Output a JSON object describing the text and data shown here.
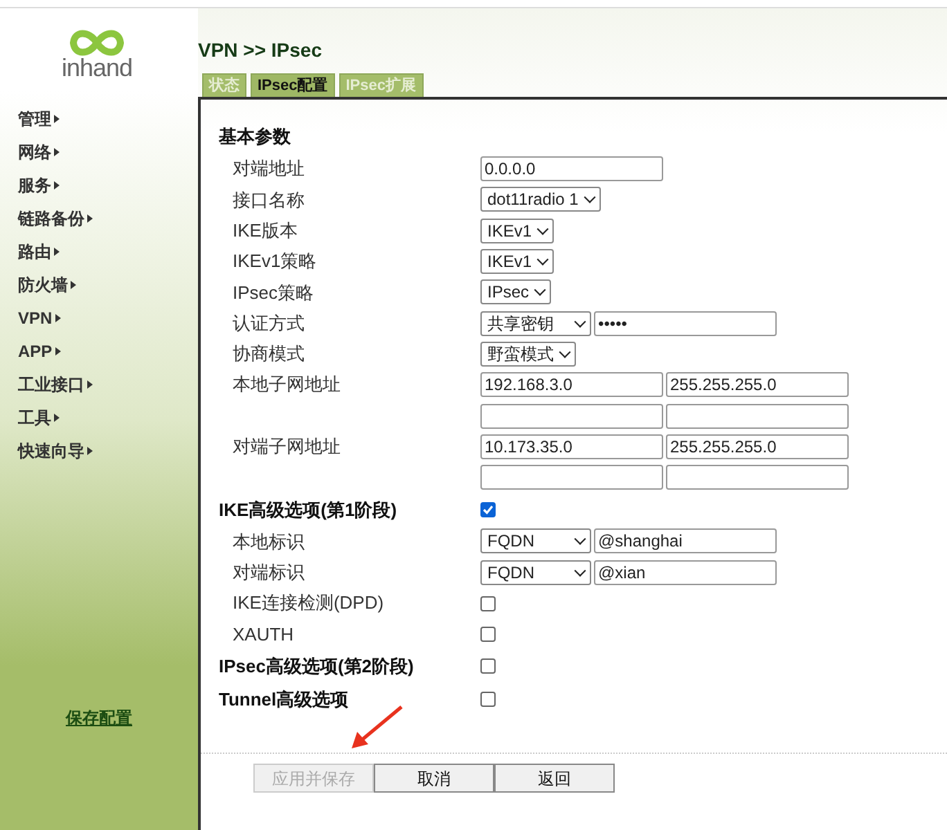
{
  "logo": {
    "text": "inhand"
  },
  "sidebar": {
    "items": [
      {
        "label": "管理"
      },
      {
        "label": "网络"
      },
      {
        "label": "服务"
      },
      {
        "label": "链路备份"
      },
      {
        "label": "路由"
      },
      {
        "label": "防火墙"
      },
      {
        "label": "VPN"
      },
      {
        "label": "APP"
      },
      {
        "label": "工业接口"
      },
      {
        "label": "工具"
      },
      {
        "label": "快速向导"
      }
    ],
    "save_link": "保存配置"
  },
  "breadcrumb": "VPN >> IPsec",
  "tabs": [
    {
      "label": "状态",
      "selected": false
    },
    {
      "label": "IPsec配置",
      "selected": true
    },
    {
      "label": "IPsec扩展",
      "selected": false
    }
  ],
  "rows": [
    {
      "kind": "heading",
      "label": "基本参数"
    },
    {
      "kind": "input",
      "label": "对端地址",
      "value": "0.0.0.0"
    },
    {
      "kind": "select",
      "label": "接口名称",
      "value": "dot11radio 1"
    },
    {
      "kind": "select",
      "label": "IKE版本",
      "value": "IKEv1"
    },
    {
      "kind": "select",
      "label": "IKEv1策略",
      "value": "IKEv1"
    },
    {
      "kind": "select",
      "label": "IPsec策略",
      "value": "IPsec"
    },
    {
      "kind": "select-input",
      "label": "认证方式",
      "value": "共享密钥",
      "input_value": "•••••"
    },
    {
      "kind": "select",
      "label": "协商模式",
      "value": "野蛮模式"
    },
    {
      "kind": "pair",
      "label": "本地子网地址",
      "values": [
        "192.168.3.0",
        "255.255.255.0"
      ]
    },
    {
      "kind": "pair"
    },
    {
      "kind": "pair",
      "label": "对端子网地址",
      "values": [
        "10.173.35.0",
        "255.255.255.0"
      ]
    },
    {
      "kind": "pair"
    },
    {
      "kind": "check-heading",
      "label": "IKE高级选项(第1阶段)",
      "checked": true
    },
    {
      "kind": "select-input",
      "label": "本地标识",
      "value": "FQDN",
      "input_value": "@shanghai"
    },
    {
      "kind": "select-input",
      "label": "对端标识",
      "value": "FQDN",
      "input_value": "@xian"
    },
    {
      "kind": "checkbox",
      "label": "IKE连接检测(DPD)",
      "checked": false
    },
    {
      "kind": "checkbox",
      "label": "XAUTH",
      "checked": false
    },
    {
      "kind": "check-heading",
      "label": "IPsec高级选项(第2阶段)",
      "checked": false
    },
    {
      "kind": "check-heading",
      "label": "Tunnel高级选项",
      "checked": false
    }
  ],
  "buttons": [
    {
      "label": "应用并保存",
      "disabled": true
    },
    {
      "label": "取消",
      "disabled": false
    },
    {
      "label": "返回",
      "disabled": false
    }
  ]
}
